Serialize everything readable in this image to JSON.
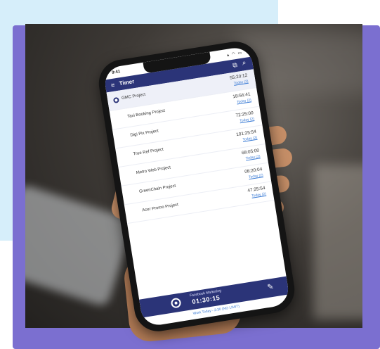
{
  "statusbar": {
    "time": "9:41",
    "icons": "▴ ◠ ▭"
  },
  "appbar": {
    "title": "Timer",
    "menu_icon": "≡",
    "sitemap_icon": "⧉",
    "search_icon": "⌕"
  },
  "projects": [
    {
      "name": "GMC Project",
      "duration": "55:20:12",
      "day": "Today (2)",
      "active": true
    },
    {
      "name": "Taxi Booking Project",
      "duration": "18:56:41",
      "day": "Today (2)",
      "active": false
    },
    {
      "name": "Digi Pix Project",
      "duration": "72:25:00",
      "day": "Today (2)",
      "active": false
    },
    {
      "name": "True Ref Project",
      "duration": "101:25:54",
      "day": "Today (2)",
      "active": false
    },
    {
      "name": "Metro Web Project",
      "duration": "68:05:00",
      "day": "Today (2)",
      "active": false
    },
    {
      "name": "GreenChain Project",
      "duration": "08:20:04",
      "day": "Today (2)",
      "active": false
    },
    {
      "name": "Acer Promo Project",
      "duration": "47:25:54",
      "day": "Today (2)",
      "active": false
    }
  ],
  "running": {
    "name": "Facebook Marketing",
    "time": "01:30:15",
    "edit_icon": "✎"
  },
  "footer_note": "Work Today - 2:30 (NO LIMIT)"
}
